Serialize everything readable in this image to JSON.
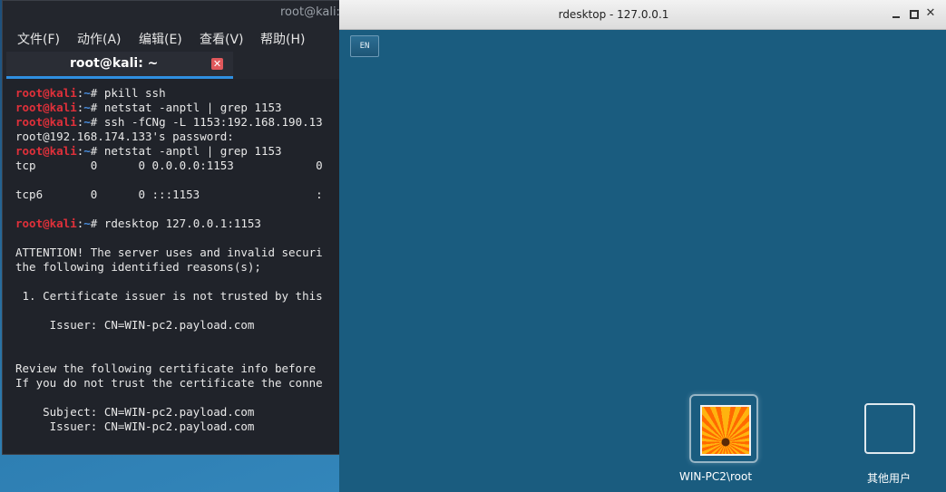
{
  "terminal": {
    "window_title": "root@kali: ~",
    "menu": [
      "文件(F)",
      "动作(A)",
      "编辑(E)",
      "查看(V)",
      "帮助(H)"
    ],
    "tab_label": "root@kali: ~",
    "prompt_user": "root@kali",
    "prompt_sep": ":",
    "prompt_path": "~",
    "prompt_hash": "# ",
    "lines": [
      {
        "prompt": true,
        "text": "pkill ssh"
      },
      {
        "prompt": true,
        "text": "netstat -anptl | grep 1153"
      },
      {
        "prompt": true,
        "text": "ssh -fCNg -L 1153:192.168.190.13"
      },
      {
        "prompt": false,
        "text": "root@192.168.174.133's password:"
      },
      {
        "prompt": true,
        "text": "netstat -anptl | grep 1153"
      },
      {
        "prompt": false,
        "text": "tcp        0      0 0.0.0.0:1153            0"
      },
      {
        "prompt": false,
        "text": ""
      },
      {
        "prompt": false,
        "text": "tcp6       0      0 :::1153                 :"
      },
      {
        "prompt": false,
        "text": ""
      },
      {
        "prompt": true,
        "text": "rdesktop 127.0.0.1:1153"
      },
      {
        "prompt": false,
        "text": ""
      },
      {
        "prompt": false,
        "text": "ATTENTION! The server uses and invalid securi"
      },
      {
        "prompt": false,
        "text": "the following identified reasons(s);"
      },
      {
        "prompt": false,
        "text": ""
      },
      {
        "prompt": false,
        "text": " 1. Certificate issuer is not trusted by this"
      },
      {
        "prompt": false,
        "text": ""
      },
      {
        "prompt": false,
        "text": "     Issuer: CN=WIN-pc2.payload.com"
      },
      {
        "prompt": false,
        "text": ""
      },
      {
        "prompt": false,
        "text": ""
      },
      {
        "prompt": false,
        "text": "Review the following certificate info before"
      },
      {
        "prompt": false,
        "text": "If you do not trust the certificate the conne"
      },
      {
        "prompt": false,
        "text": ""
      },
      {
        "prompt": false,
        "text": "    Subject: CN=WIN-pc2.payload.com"
      },
      {
        "prompt": false,
        "text": "     Issuer: CN=WIN-pc2.payload.com"
      }
    ]
  },
  "rdesktop": {
    "title": "rdesktop - 127.0.0.1",
    "language": "EN",
    "users": [
      {
        "name": "WIN-PC2\\root",
        "icon": "flower-avatar-icon"
      },
      {
        "name": "其他用户",
        "icon": "blank-avatar-icon"
      }
    ]
  },
  "colors": {
    "prompt_user": "#e0303a",
    "prompt_path": "#4a8fe0",
    "tab_accent": "#2f8fe0",
    "rdp_background": "#1a5c7f"
  }
}
